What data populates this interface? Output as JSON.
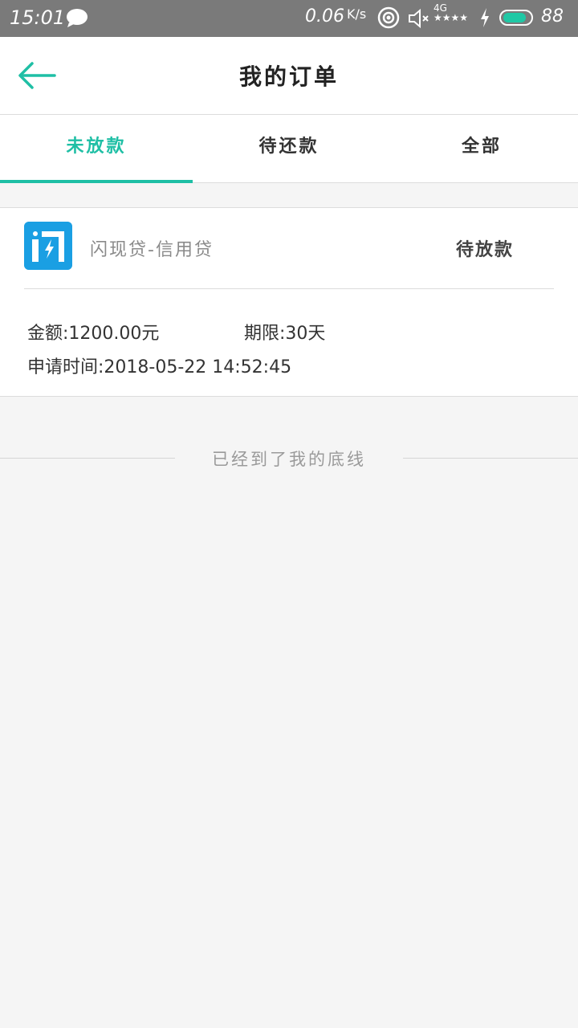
{
  "status_bar": {
    "time": "15:01",
    "net_speed": "0.06",
    "net_speed_unit": "K/s",
    "signal_label": "4G",
    "battery_level": "88",
    "battery_fraction": 0.88,
    "accent_color": "#1fc8a5",
    "icons": [
      "chat-bubble-icon",
      "hotspot-icon",
      "mute-icon",
      "signal-icon",
      "charging-icon",
      "battery-icon"
    ]
  },
  "header": {
    "title": "我的订单",
    "back_icon": "arrow-left-icon"
  },
  "tabs": [
    {
      "label": "未放款",
      "active": true
    },
    {
      "label": "待还款",
      "active": false
    },
    {
      "label": "全部",
      "active": false
    }
  ],
  "order": {
    "product_name": "闪现贷-信用贷",
    "status": "待放款",
    "amount_label": "金额:",
    "amount_value": "1200.00元",
    "term_label": "期限:",
    "term_value": "30天",
    "apply_time_label": "申请时间:",
    "apply_time_value": "2018-05-22 14:52:45",
    "icon": "flash-loan-app-icon",
    "icon_color": "#1a9fe3"
  },
  "footer": {
    "end_text": "已经到了我的底线"
  },
  "colors": {
    "accent": "#1fbfa5",
    "background": "#f5f5f5"
  }
}
